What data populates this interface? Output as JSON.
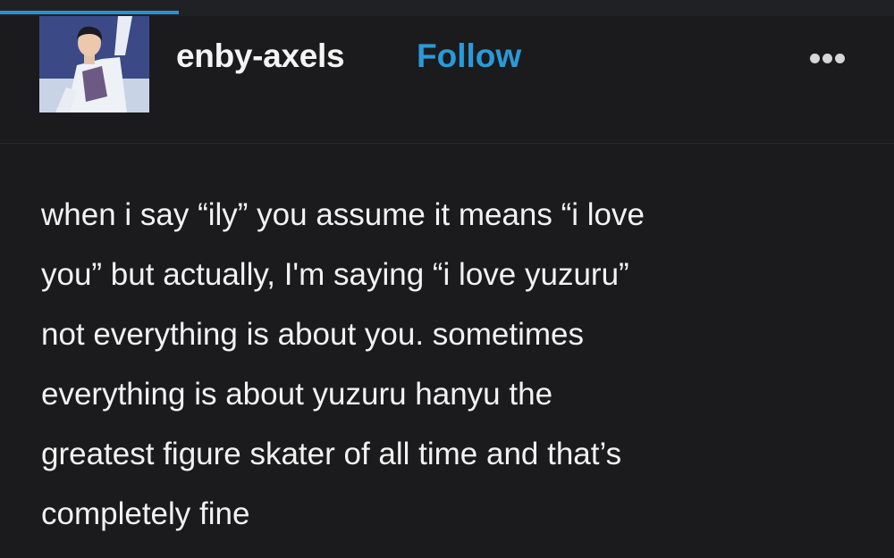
{
  "header": {
    "username": "enby-axels",
    "follow_label": "Follow",
    "avatar_icon": "skater-avatar-icon",
    "more_icon": "ellipsis-icon"
  },
  "post": {
    "lines": [
      "when i say “ily” you assume it means “i love",
      "you” but actually, I'm saying “i love yuzuru”",
      "not everything is about you. sometimes",
      "everything is about yuzuru hanyu the",
      "greatest figure skater of all time and that’s",
      "completely fine"
    ]
  },
  "colors": {
    "background": "#1b1b1d",
    "accent": "#2a9ad8",
    "text": "#f2f2f2"
  }
}
